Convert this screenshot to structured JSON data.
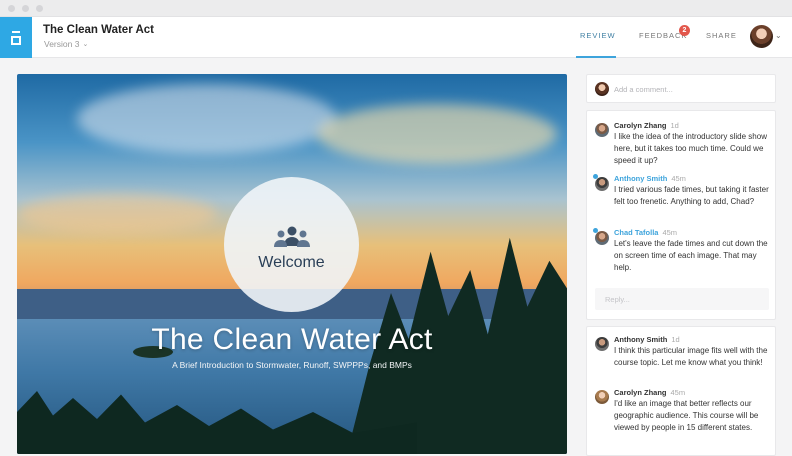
{
  "header": {
    "title": "The Clean Water Act",
    "version": "Version 3",
    "nav": {
      "review": "REVIEW",
      "feedback": "FEEDBACK",
      "feedback_count": "2",
      "share": "SHARE"
    }
  },
  "slide": {
    "welcome": "Welcome",
    "title": "The Clean Water Act",
    "subtitle": "A Brief Introduction to Stormwater, Runoff, SWPPPs, and BMPs"
  },
  "sidebar": {
    "comment_placeholder": "Add a comment...",
    "reply_placeholder": "Reply...",
    "threads": [
      {
        "comments": [
          {
            "name": "Carolyn Zhang",
            "time": "1d",
            "text": "I like the idea of the introductory slide show here, but it takes too much time. Could we speed it up?"
          },
          {
            "name": "Anthony Smith",
            "time": "45m",
            "text": "I tried various fade times, but taking it faster felt too frenetic. Anything to add, Chad?"
          },
          {
            "name": "Chad Tafolla",
            "time": "45m",
            "text": "Let's leave the fade times and cut down the on screen time of each image. That may help."
          }
        ]
      },
      {
        "comments": [
          {
            "name": "Anthony Smith",
            "time": "1d",
            "text": "I think this particular image fits well with the course topic. Let me know what you think!"
          },
          {
            "name": "Carolyn Zhang",
            "time": "45m",
            "text": "I'd like an image that better reflects our geographic audience. This course will be viewed by people in 15 different states."
          }
        ]
      }
    ]
  },
  "colors": {
    "accent": "#3ea4dc",
    "logo": "#2ea8e4",
    "badge": "#e2574c"
  },
  "icons": [
    "logo-icon",
    "chevron-down-icon",
    "group-icon"
  ]
}
